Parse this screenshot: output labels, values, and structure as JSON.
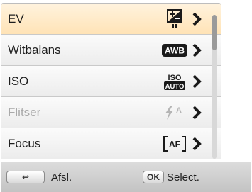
{
  "menu": {
    "items": [
      {
        "label": "EV",
        "icon": "ev-exposure-icon",
        "state": "selected"
      },
      {
        "label": "Witbalans",
        "icon": "awb-icon",
        "badge": "AWB",
        "state": "normal"
      },
      {
        "label": "ISO",
        "icon": "iso-auto-icon",
        "badge_top": "ISO",
        "badge_bottom": "AUTO",
        "state": "normal"
      },
      {
        "label": "Flitser",
        "icon": "flash-auto-icon",
        "badge": "A",
        "state": "disabled"
      },
      {
        "label": "Focus",
        "icon": "af-icon",
        "badge": "AF",
        "state": "normal"
      }
    ],
    "scroll_position": 0
  },
  "bottom_bar": {
    "back": {
      "key": "↩",
      "label": "Afsl."
    },
    "select": {
      "key": "OK",
      "label": "Select."
    }
  }
}
